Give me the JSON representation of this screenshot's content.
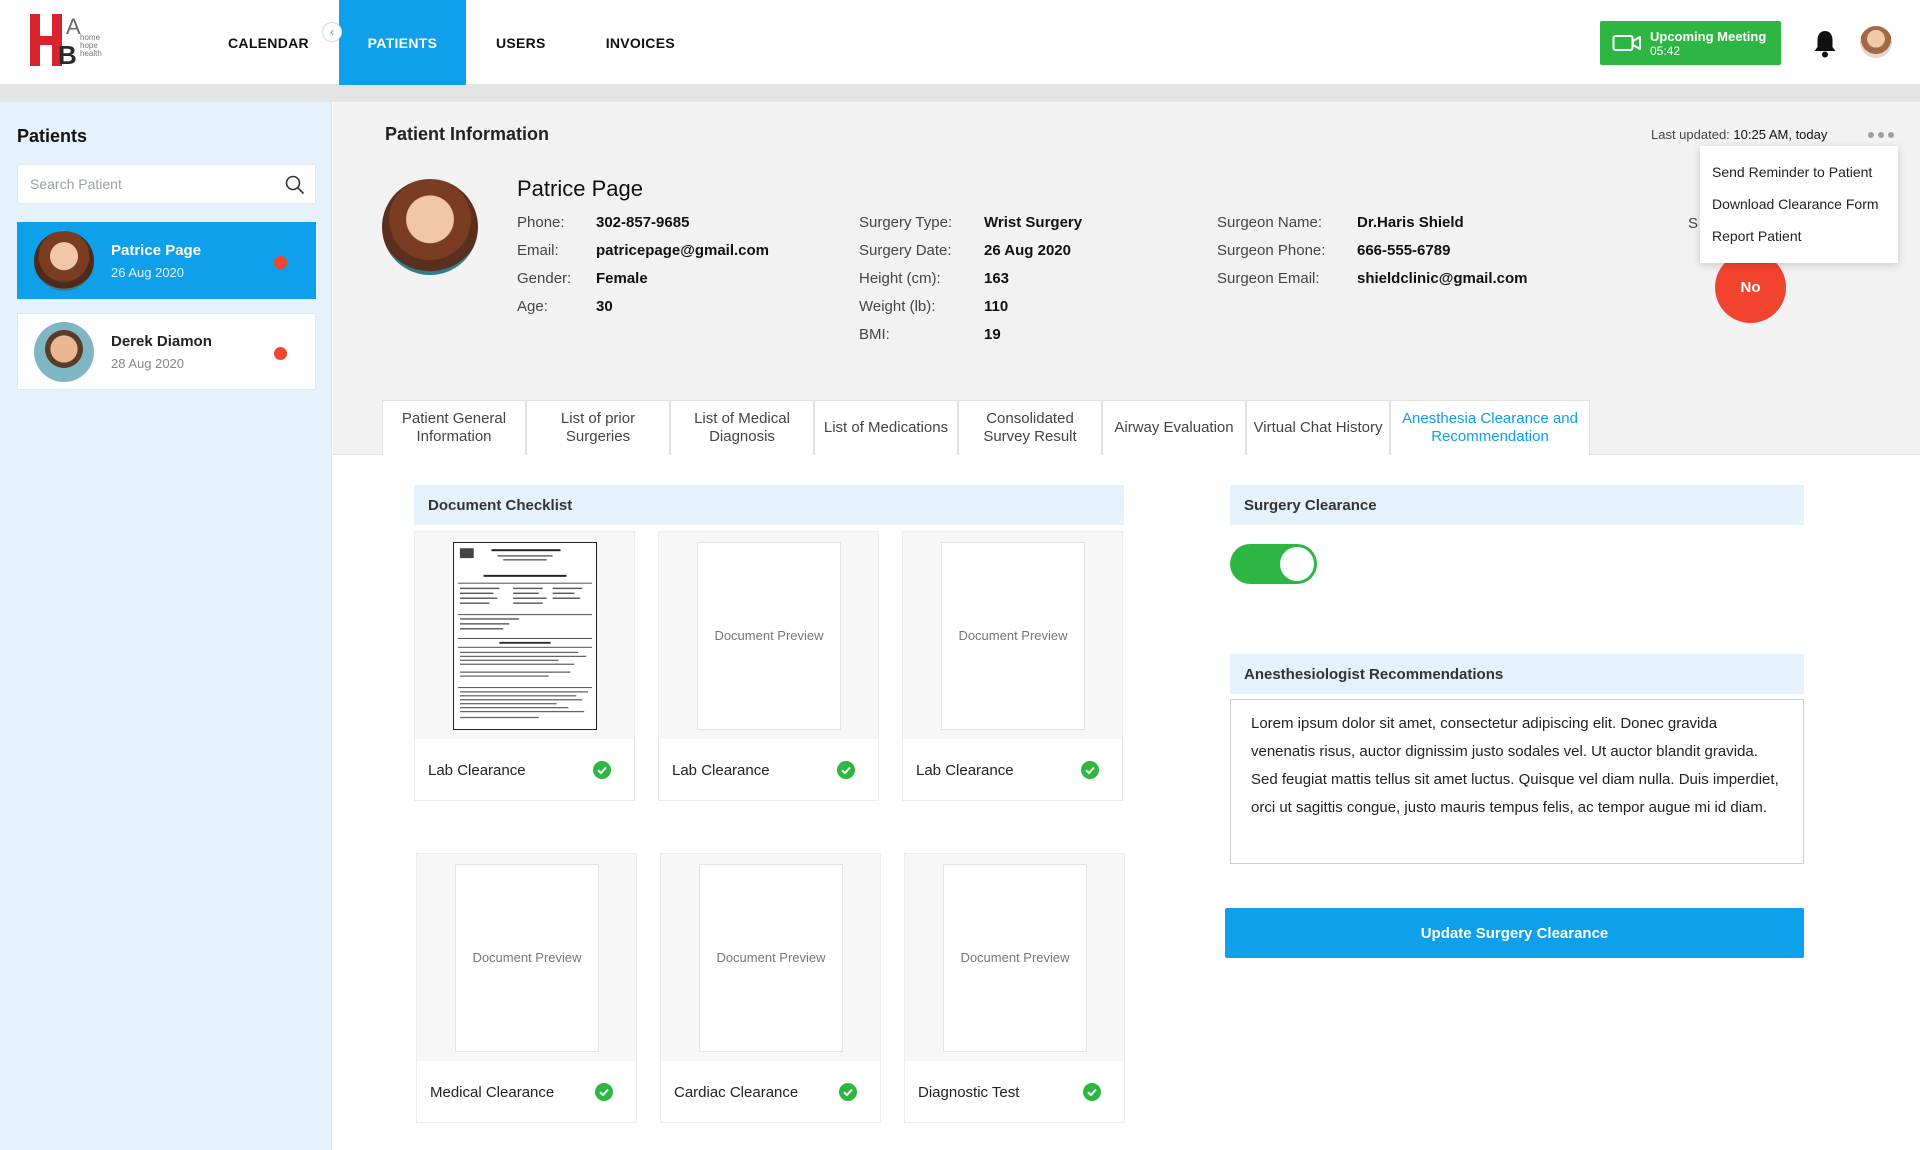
{
  "header": {
    "logo_text": "home hope health",
    "nav": [
      {
        "label": "CALENDAR",
        "active": false
      },
      {
        "label": "PATIENTS",
        "active": true
      },
      {
        "label": "USERS",
        "active": false
      },
      {
        "label": "INVOICES",
        "active": false
      }
    ],
    "meeting": {
      "label": "Upcoming Meeting",
      "time": "05:42",
      "icon": "video-camera-icon"
    },
    "bell_icon": "bell-icon",
    "accent_color": "#0ea0ea",
    "meeting_color": "#2db742"
  },
  "sidebar": {
    "title": "Patients",
    "search_placeholder": "Search Patient",
    "patients": [
      {
        "name": "Patrice Page",
        "date": "26 Aug 2020",
        "active": true,
        "status_color": "#f2432f"
      },
      {
        "name": "Derek Diamon",
        "date": "28 Aug 2020",
        "active": false,
        "status_color": "#f2432f"
      }
    ]
  },
  "patient_info": {
    "section_title": "Patient Information",
    "last_updated_label": "Last updated:",
    "last_updated_value": "10:25 AM, today",
    "name": "Patrice Page",
    "col1": [
      {
        "label": "Phone:",
        "value": "302-857-9685"
      },
      {
        "label": "Email:",
        "value": "patricepage@gmail.com"
      },
      {
        "label": "Gender:",
        "value": "Female"
      },
      {
        "label": "Age:",
        "value": "30"
      }
    ],
    "col2": [
      {
        "label": "Surgery Type:",
        "value": "Wrist Surgery"
      },
      {
        "label": "Surgery Date:",
        "value": "26 Aug 2020"
      },
      {
        "label": "Height (cm):",
        "value": "163"
      },
      {
        "label": "Weight (lb):",
        "value": "110"
      },
      {
        "label": "BMI:",
        "value": "19"
      }
    ],
    "col3": [
      {
        "label": "Surgeon Name:",
        "value": "Dr.Haris Shield"
      },
      {
        "label": "Surgeon Phone:",
        "value": "666-555-6789"
      },
      {
        "label": "Surgeon Email:",
        "value": "shieldclinic@gmail.com"
      }
    ],
    "clearance_badge": "No",
    "clearance_color": "#f2432f",
    "partial_label": "S",
    "menu": [
      "Send Reminder to Patient",
      "Download Clearance Form",
      "Report Patient"
    ]
  },
  "tabs": [
    {
      "label": "Patient General Information",
      "active": false
    },
    {
      "label": "List of prior Surgeries",
      "active": false
    },
    {
      "label": "List of Medical Diagnosis",
      "active": false
    },
    {
      "label": "List of Medications",
      "active": false
    },
    {
      "label": "Consolidated Survey Result",
      "active": false
    },
    {
      "label": "Airway Evaluation",
      "active": false
    },
    {
      "label": "Virtual Chat History",
      "active": false
    },
    {
      "label": "Anesthesia Clearance and Recommendation",
      "active": true
    }
  ],
  "checklist": {
    "title": "Document Checklist",
    "preview_text": "Document Preview",
    "documents": [
      {
        "label": "Lab Clearance",
        "scanned": true,
        "checked": true
      },
      {
        "label": "Lab Clearance",
        "scanned": false,
        "checked": true
      },
      {
        "label": "Lab Clearance",
        "scanned": false,
        "checked": true
      },
      {
        "label": "Medical Clearance",
        "scanned": false,
        "checked": true
      },
      {
        "label": "Cardiac Clearance",
        "scanned": false,
        "checked": true
      },
      {
        "label": "Diagnostic Test",
        "scanned": false,
        "checked": true
      }
    ],
    "check_color": "#2db742"
  },
  "surgery_clearance": {
    "title": "Surgery Clearance",
    "toggle_on": true
  },
  "recommendations": {
    "title": "Anesthesiologist  Recommendations",
    "text": "Lorem ipsum dolor sit amet, consectetur adipiscing elit. Donec gravida venenatis risus, auctor dignissim justo sodales vel. Ut auctor blandit gravida. Sed feugiat mattis tellus sit amet luctus. Quisque vel diam nulla. Duis imperdiet, orci ut sagittis congue, justo mauris tempus felis, ac tempor augue mi id diam."
  },
  "update_button": "Update Surgery Clearance"
}
